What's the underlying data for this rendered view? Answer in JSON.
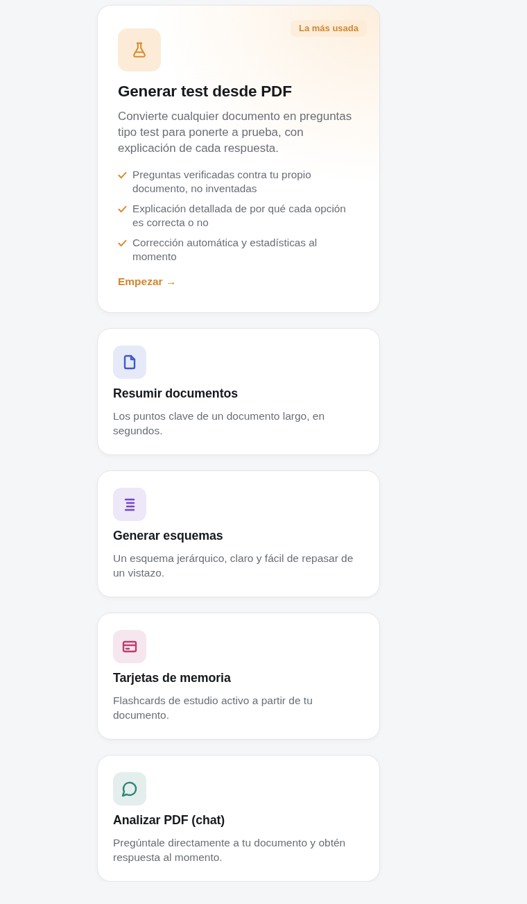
{
  "featured": {
    "badge": "La más usada",
    "title": "Generar test desde PDF",
    "description": "Convierte cualquier documento en preguntas tipo test para ponerte a prueba, con explicación de cada respuesta.",
    "features": [
      "Preguntas verificadas contra tu propio documento, no inventadas",
      "Explicación detallada de por qué cada opción es correcta o no",
      "Corrección automática y estadísticas al momento"
    ],
    "action": "Empezar →"
  },
  "tools": [
    {
      "title": "Resumir documentos",
      "description": "Los puntos clave de un documento largo, en segundos.",
      "color": "#3d5bc9"
    },
    {
      "title": "Generar esquemas",
      "description": "Un esquema jerárquico, claro y fácil de repasar de un vistazo.",
      "color": "#7446c9"
    },
    {
      "title": "Tarjetas de memoria",
      "description": "Flashcards de estudio activo a partir de tu documento.",
      "color": "#b93f72"
    },
    {
      "title": "Analizar PDF (chat)",
      "description": "Pregúntale directamente a tu documento y obtén respuesta al momento.",
      "color": "#2f8574"
    }
  ]
}
